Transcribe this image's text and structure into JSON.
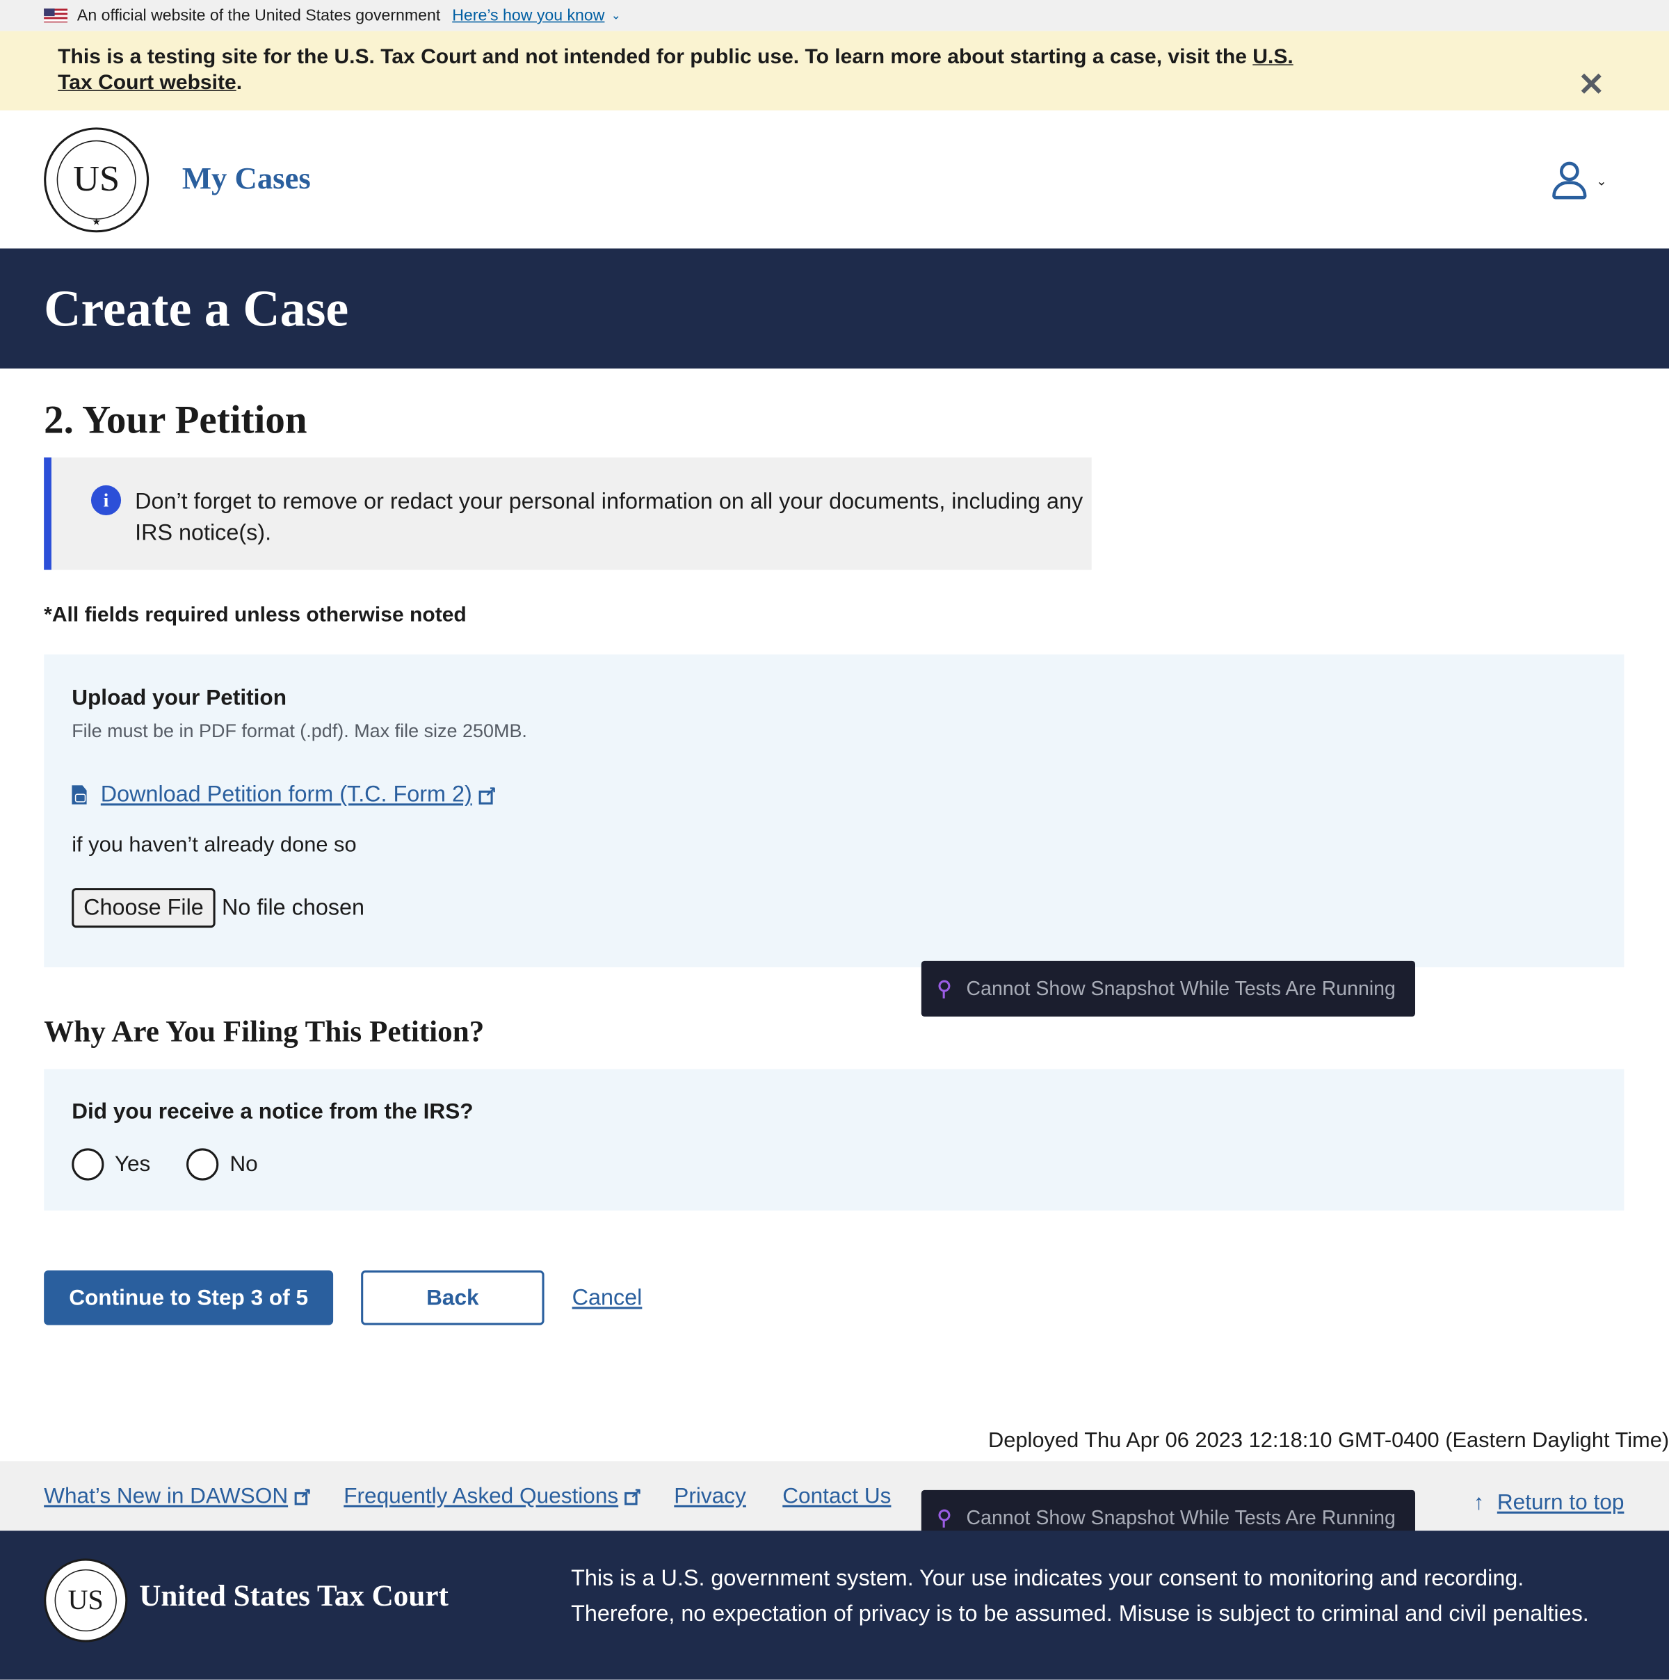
{
  "gov_banner": {
    "text": "An official website of the United States government",
    "link": "Here’s how you know"
  },
  "test_banner": {
    "text": "This is a testing site for the U.S. Tax Court and not intended for public use. To learn more about starting a case, visit the ",
    "link": "U.S. Tax Court website",
    "suffix": "."
  },
  "header": {
    "seal_letters": "US",
    "nav_title": "My Cases"
  },
  "page_title": "Create a Case",
  "step": {
    "title": "2. Your Petition",
    "alert": "Don’t forget to remove or redact your personal information on all your documents, including any IRS notice(s).",
    "required_note": "*All fields required unless otherwise noted"
  },
  "upload": {
    "label": "Upload your Petition",
    "hint": "File must be in PDF format (.pdf). Max file size 250MB.",
    "download_link": "Download Petition form (T.C. Form 2)",
    "after_link": "if you haven’t already done so",
    "choose_button": "Choose File",
    "file_status": "No file chosen"
  },
  "why": {
    "title": "Why Are You Filing This Petition?",
    "question": "Did you receive a notice from the IRS?",
    "options": [
      "Yes",
      "No"
    ]
  },
  "actions": {
    "continue": "Continue to Step 3 of 5",
    "back": "Back",
    "cancel": "Cancel"
  },
  "overlay": {
    "snapshot_message": "Cannot Show Snapshot While Tests Are Running"
  },
  "deployed": "Deployed Thu Apr 06 2023 12:18:10 GMT-0400 (Eastern Daylight Time)",
  "footer": {
    "links": [
      "What’s New in DAWSON",
      "Frequently Asked Questions",
      "Privacy",
      "Contact Us"
    ],
    "return_top": "Return to top",
    "org_name": "United States Tax Court",
    "disclaimer": "This is a U.S. government system. Your use indicates your consent to monitoring and recording. Therefore, no expectation of privacy is to be assumed. Misuse is subject to criminal and civil penalties."
  },
  "colors": {
    "primary": "#2a5f9e",
    "navy": "#1e2b4b",
    "test_banner_bg": "#faf3d1",
    "alert_border": "#2c4fd8",
    "form_box_bg": "#eff6fb"
  }
}
